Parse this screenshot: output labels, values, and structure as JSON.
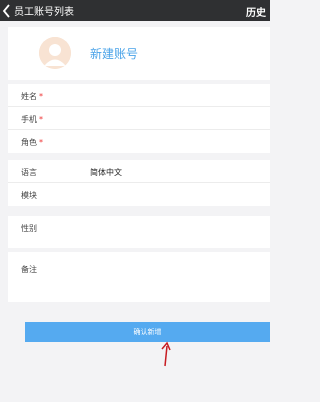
{
  "topbar": {
    "back_label": "员工账号列表",
    "history_label": "历史"
  },
  "profile": {
    "title": "新建账号"
  },
  "fields_required": [
    {
      "label": "姓名",
      "required_mark": "*"
    },
    {
      "label": "手机",
      "required_mark": "*"
    },
    {
      "label": "角色",
      "required_mark": "*"
    }
  ],
  "fields_optional": [
    {
      "label": "语言",
      "value": "简体中文"
    },
    {
      "label": "模块",
      "value": ""
    }
  ],
  "field_gender": {
    "label": "性别"
  },
  "field_remark": {
    "label": "备注"
  },
  "confirm_button": {
    "label": "确认新增"
  },
  "colors": {
    "accent": "#4aa3e8",
    "button": "#55aaf0",
    "topbar": "#2f3032",
    "required": "#e33333"
  }
}
